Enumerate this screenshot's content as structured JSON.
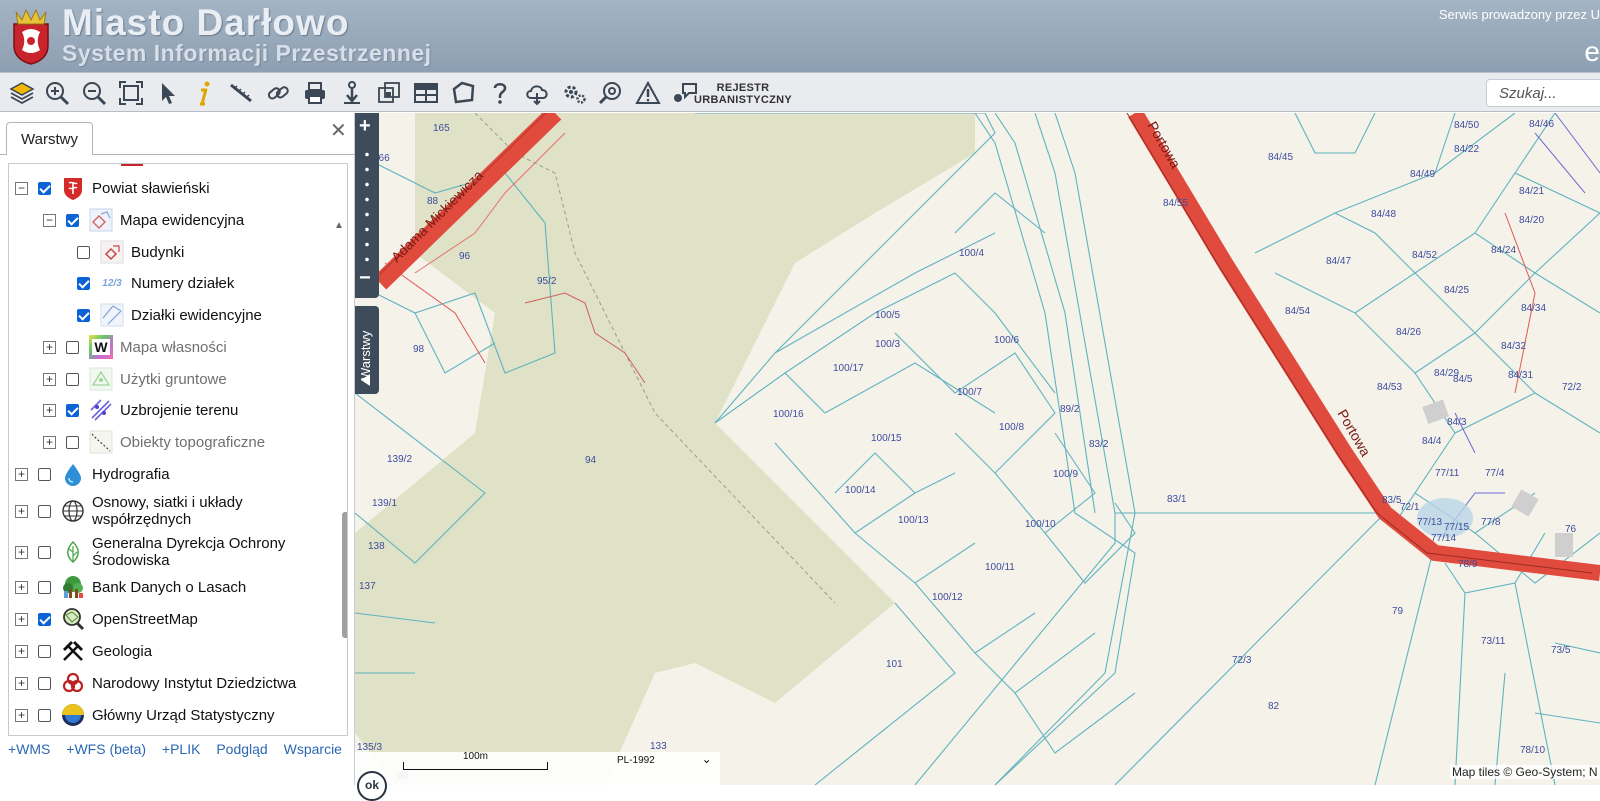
{
  "header": {
    "title": "Miasto Darłowo",
    "subtitle": "System Informacji Przestrzennej",
    "service_note": "Serwis prowadzony przez U",
    "service_logo_text": "e"
  },
  "toolbar": {
    "tools": [
      "layers-icon",
      "zoom-in-icon",
      "zoom-out-icon",
      "zoom-extent-icon",
      "pointer-icon",
      "info-icon",
      "measure-distance-icon",
      "link-icon",
      "print-icon",
      "download-icon",
      "compare-icon",
      "table-icon",
      "polygon-icon",
      "help-icon",
      "cloud-icon",
      "settings-icon",
      "location-search-icon",
      "warning-icon",
      "comment-icon"
    ],
    "registry_label_1": "REJESTR",
    "registry_label_2": "URBANISTYCZNY",
    "search_placeholder": "Szukaj..."
  },
  "panel": {
    "tab_label": "Warstwy",
    "layers": [
      {
        "label": "Powiat sławieński",
        "checked": true,
        "expander": "−",
        "level": 0,
        "dim": false
      },
      {
        "label": "Mapa ewidencyjna",
        "checked": true,
        "expander": "−",
        "level": 1,
        "dim": false
      },
      {
        "label": "Budynki",
        "checked": false,
        "expander": "",
        "level": 2,
        "dim": false
      },
      {
        "label": "Numery działek",
        "checked": true,
        "expander": "",
        "level": 2,
        "dim": false,
        "icon_text": "12/3"
      },
      {
        "label": "Działki ewidencyjne",
        "checked": true,
        "expander": "",
        "level": 2,
        "dim": false
      },
      {
        "label": "Mapa własności",
        "checked": false,
        "expander": "+",
        "level": 1,
        "dim": true,
        "icon_text": "W"
      },
      {
        "label": "Użytki gruntowe",
        "checked": false,
        "expander": "+",
        "level": 1,
        "dim": true
      },
      {
        "label": "Uzbrojenie terenu",
        "checked": true,
        "expander": "+",
        "level": 1,
        "dim": false
      },
      {
        "label": "Obiekty topograficzne",
        "checked": false,
        "expander": "+",
        "level": 1,
        "dim": true
      },
      {
        "label": "Hydrografia",
        "checked": false,
        "expander": "+",
        "level": 0,
        "dim": false
      },
      {
        "label": "Osnowy, siatki i układy współrzędnych",
        "checked": false,
        "expander": "+",
        "level": 0,
        "dim": false
      },
      {
        "label": "Generalna Dyrekcja Ochrony Środowiska",
        "checked": false,
        "expander": "+",
        "level": 0,
        "dim": false
      },
      {
        "label": "Bank Danych o Lasach",
        "checked": false,
        "expander": "+",
        "level": 0,
        "dim": false
      },
      {
        "label": "OpenStreetMap",
        "checked": true,
        "expander": "+",
        "level": 0,
        "dim": false
      },
      {
        "label": "Geologia",
        "checked": false,
        "expander": "+",
        "level": 0,
        "dim": false
      },
      {
        "label": "Narodowy Instytut Dziedzictwa",
        "checked": false,
        "expander": "+",
        "level": 0,
        "dim": false
      },
      {
        "label": "Główny Urząd Statystyczny",
        "checked": false,
        "expander": "+",
        "level": 0,
        "dim": false
      }
    ],
    "links": [
      "+WMS",
      "+WFS (beta)",
      "+PLIK",
      "Podgląd",
      "Wsparcie"
    ]
  },
  "map": {
    "zoom_in": "+",
    "zoom_out": "−",
    "layers_tab": "Warstwy",
    "street_labels": [
      "Adama Mickiewicza",
      "Portowa",
      "Portowa"
    ],
    "parcels": [
      "165",
      "166",
      "88",
      "96",
      "95/2",
      "98",
      "94",
      "139/2",
      "139/1",
      "138",
      "137",
      "100/4",
      "100/5",
      "100/3",
      "100/6",
      "100/17",
      "100/16",
      "100/7",
      "100/15",
      "100/8",
      "100/14",
      "89/2",
      "83/2",
      "100/9",
      "100/13",
      "100/10",
      "100/11",
      "100/12",
      "101",
      "83/1",
      "84/55",
      "84/46",
      "84/50",
      "84/45",
      "84/22",
      "84/49",
      "84/21",
      "84/48",
      "84/20",
      "84/47",
      "84/52",
      "84/24",
      "84/25",
      "84/54",
      "84/34",
      "84/26",
      "84/32",
      "84/29",
      "84/53",
      "84/5",
      "84/31",
      "72/2",
      "84/3",
      "84/4",
      "77/11",
      "77/4",
      "83/5",
      "72/1",
      "77/13",
      "77/15",
      "77/14",
      "77/8",
      "76",
      "78/9",
      "79",
      "73/11",
      "73/5",
      "72/3",
      "82",
      "135/3",
      "99",
      "133",
      "78/10"
    ],
    "scale_label": "100m",
    "crs_label": "PL-1992",
    "ok_label": "ok",
    "attribution": "Map tiles © Geo-System; N"
  }
}
